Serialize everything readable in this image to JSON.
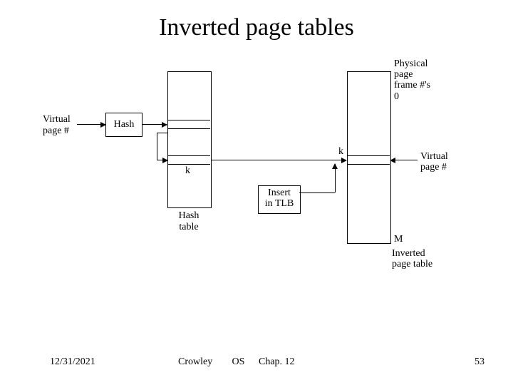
{
  "title": "Inverted page tables",
  "diagram": {
    "virtual_page_label": "Virtual\npage #",
    "hash_box": "Hash",
    "hash_table_label": "Hash\ntable",
    "k1": "k",
    "k2": "k",
    "insert_tlb": "Insert\nin TLB",
    "phys_frame_label": "Physical\npage\nframe #'s",
    "zero": "0",
    "M": "M",
    "inv_label": "Inverted\npage table",
    "virtual_page_label2": "Virtual\npage #"
  },
  "footer": {
    "date": "12/31/2021",
    "author": "Crowley",
    "course": "OS",
    "chapter": "Chap. 12",
    "page": "53"
  }
}
